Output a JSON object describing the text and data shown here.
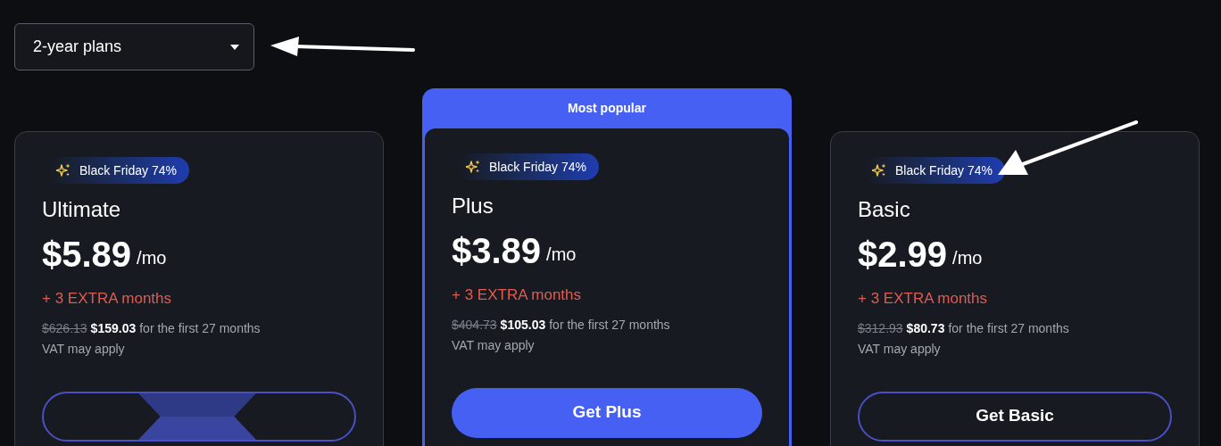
{
  "plan_selector": {
    "value": "2-year plans",
    "annotated": true
  },
  "plans": [
    {
      "badge": "Black Friday 74%",
      "badge_annotated": false,
      "name": "Ultimate",
      "price": "$5.89",
      "period": "/mo",
      "bonus": "+ 3 EXTRA months",
      "old_price": "$626.13",
      "new_price": "$159.03",
      "term": "for the first 27 months",
      "note": "VAT may apply",
      "popular": false,
      "button": {
        "kind": "loading"
      }
    },
    {
      "ribbon": "Most popular",
      "badge": "Black Friday 74%",
      "badge_annotated": false,
      "name": "Plus",
      "price": "$3.89",
      "period": "/mo",
      "bonus": "+ 3 EXTRA months",
      "old_price": "$404.73",
      "new_price": "$105.03",
      "term": "for the first 27 months",
      "note": "VAT may apply",
      "popular": true,
      "button": {
        "kind": "filled",
        "label": "Get Plus"
      }
    },
    {
      "badge": "Black Friday 74%",
      "badge_annotated": true,
      "name": "Basic",
      "price": "$2.99",
      "period": "/mo",
      "bonus": "+ 3 EXTRA months",
      "old_price": "$312.93",
      "new_price": "$80.73",
      "term": "for the first 27 months",
      "note": "VAT may apply",
      "popular": false,
      "button": {
        "kind": "outline",
        "label": "Get Basic"
      }
    }
  ]
}
